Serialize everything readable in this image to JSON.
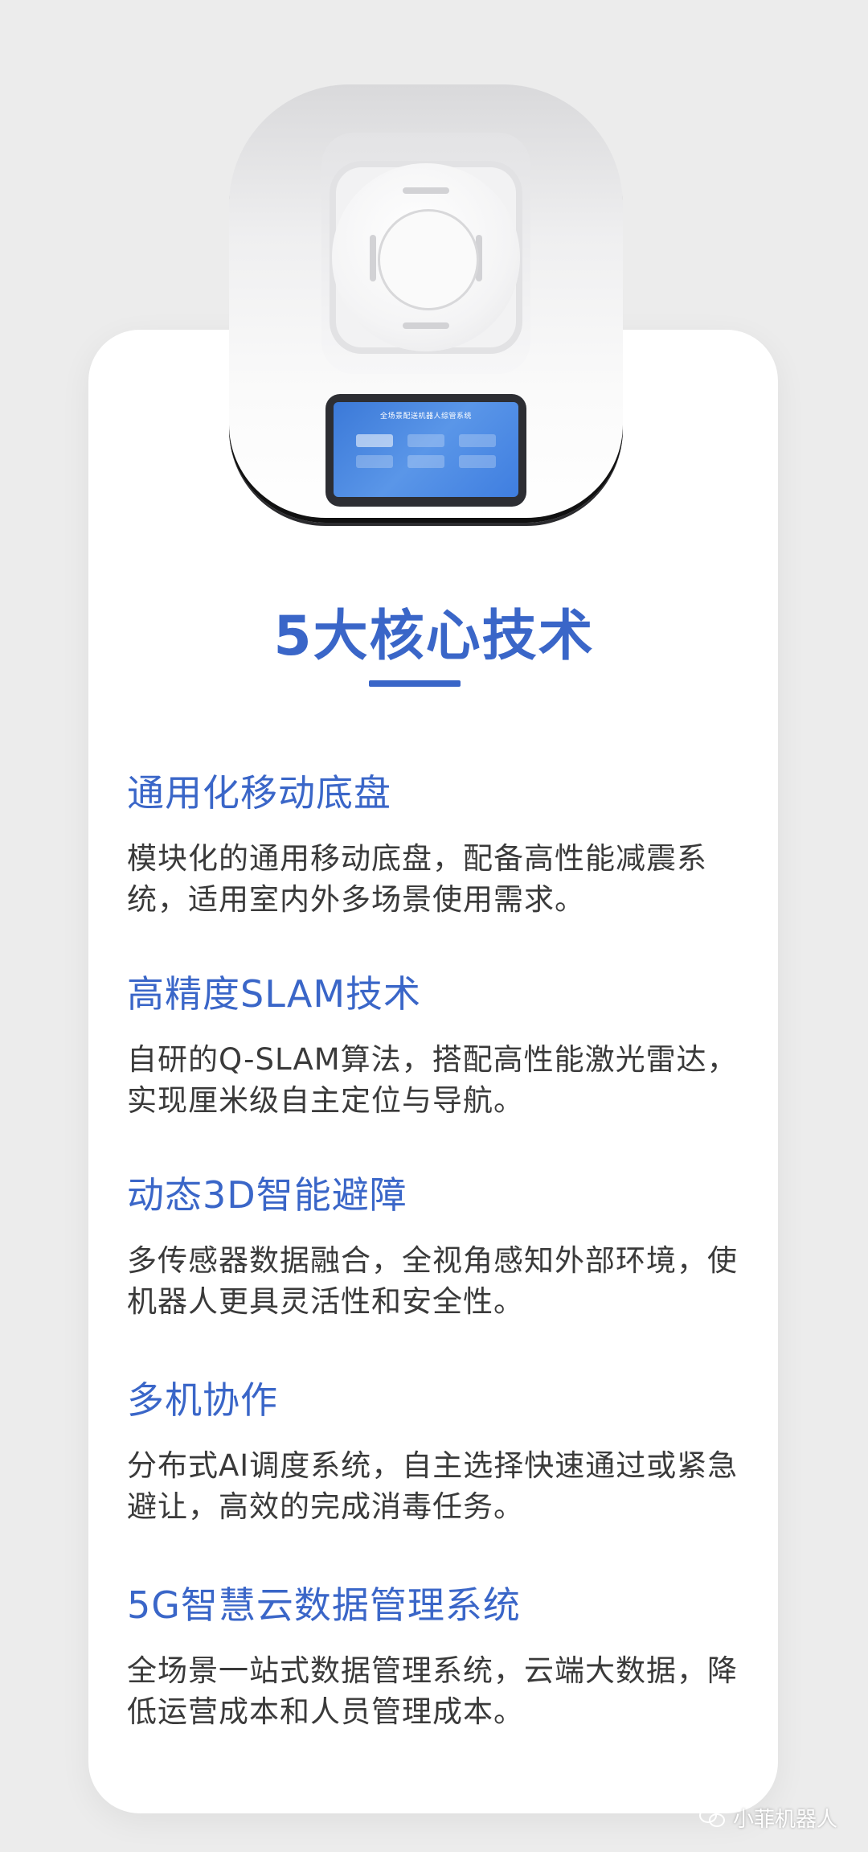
{
  "screen": {
    "title": "全场景配送机器人综管系统",
    "buttons": [
      "",
      "",
      "",
      "",
      "",
      ""
    ]
  },
  "heading": "5大核心技术",
  "sections": [
    {
      "title": "通用化移动底盘",
      "text": "模块化的通用移动底盘，配备高性能减震系统，适用室内外多场景使用需求。"
    },
    {
      "title": "高精度SLAM技术",
      "text": "自研的Q-SLAM算法，搭配高性能激光雷达，实现厘米级自主定位与导航。"
    },
    {
      "title": "动态3D智能避障",
      "text": "多传感器数据融合，全视角感知外部环境，使机器人更具灵活性和安全性。"
    },
    {
      "title": "多机协作",
      "text": "分布式AI调度系统，自主选择快速通过或紧急避让，高效的完成消毒任务。"
    },
    {
      "title": "5G智慧云数据管理系统",
      "text": "全场景一站式数据管理系统，云端大数据，降低运营成本和人员管理成本。"
    }
  ],
  "watermark": "小菲机器人",
  "colors": {
    "accent": "#3a66c8",
    "text": "#3a3a3a",
    "background": "#ececec",
    "card": "#ffffff"
  }
}
